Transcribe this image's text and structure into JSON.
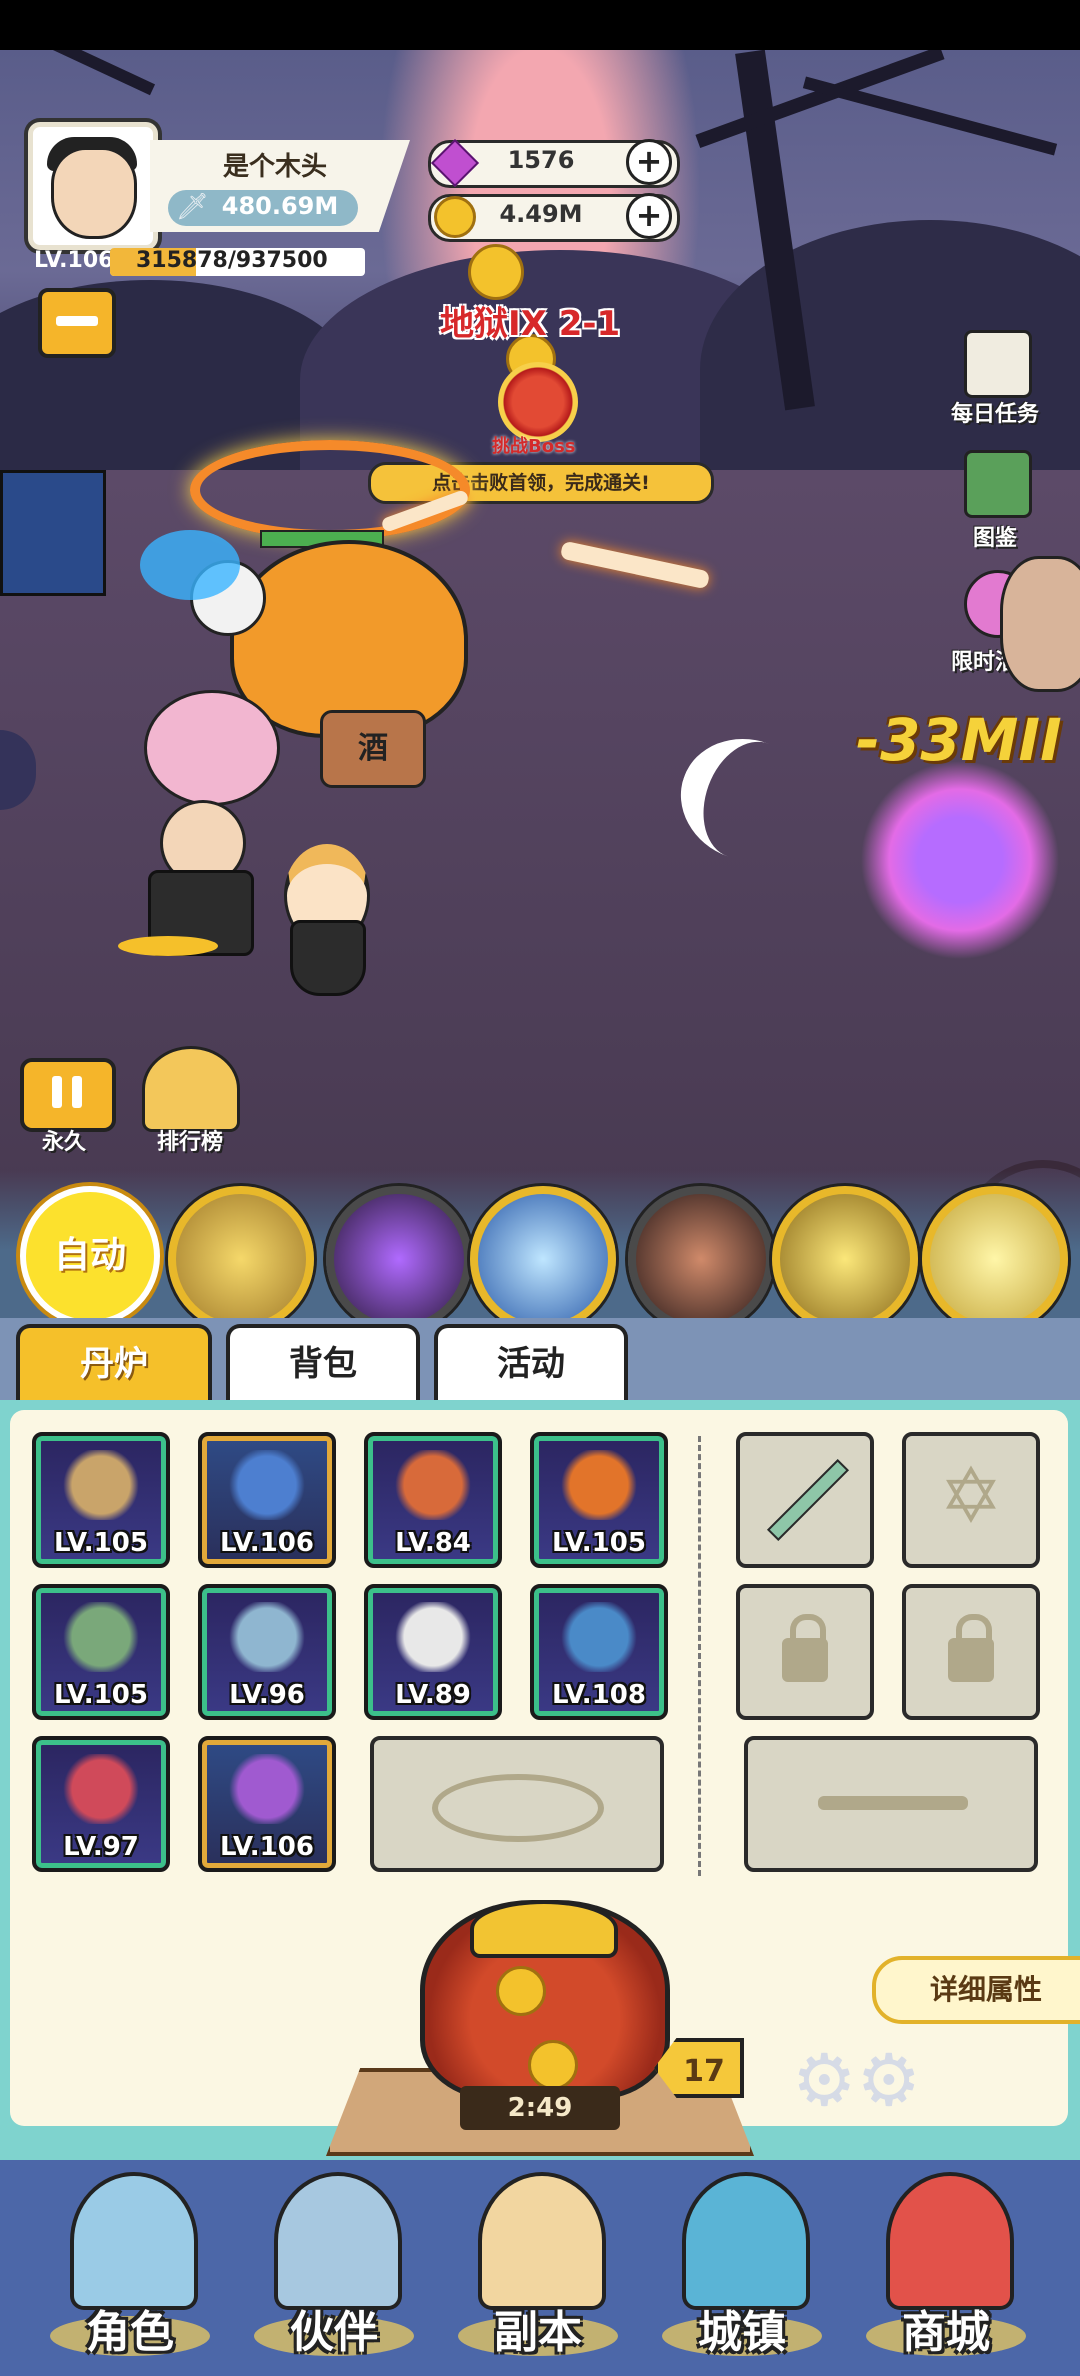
{
  "player": {
    "name": "是个木头",
    "power": "480.69M",
    "level": "LV.106",
    "exp_text": "315878/937500",
    "exp_fraction": 0.337
  },
  "currency": {
    "gems": "1576",
    "gold": "4.49M"
  },
  "stage": {
    "title": "地狱IX 2-1",
    "boss_label": "挑战Boss",
    "tip": "点击击败首领，完成通关!"
  },
  "side_menu": {
    "daily_tasks": "每日任务",
    "codex": "图鉴",
    "limited_events": "限时活动"
  },
  "battle": {
    "damage_number": "-33MII",
    "barrel_label": "酒"
  },
  "controls": {
    "pause_label": "永久",
    "ranking_label": "排行榜",
    "auto_label": "自动"
  },
  "tabs": [
    "丹炉",
    "背包",
    "活动"
  ],
  "equipment": [
    {
      "level": "LV.105",
      "frame": "green",
      "color": "#c9a46a"
    },
    {
      "level": "LV.106",
      "frame": "gold",
      "color": "#4d7fd0"
    },
    {
      "level": "LV.84",
      "frame": "green",
      "color": "#d86a3a"
    },
    {
      "level": "LV.105",
      "frame": "green",
      "color": "#e2742a"
    },
    {
      "level": "LV.105",
      "frame": "green",
      "color": "#7aa87a"
    },
    {
      "level": "LV.96",
      "frame": "green",
      "color": "#8fb6d0"
    },
    {
      "level": "LV.89",
      "frame": "green",
      "color": "#e8e8e8"
    },
    {
      "level": "LV.108",
      "frame": "green",
      "color": "#4a8ac8"
    },
    {
      "level": "LV.97",
      "frame": "green",
      "color": "#d04a5a"
    },
    {
      "level": "LV.106",
      "frame": "gold",
      "color": "#a05ad0"
    }
  ],
  "furnace": {
    "timer": "2:49",
    "speed": "17"
  },
  "detail_button": "详细属性",
  "bottom_nav": [
    "角色",
    "伙伴",
    "副本",
    "城镇",
    "商城"
  ]
}
